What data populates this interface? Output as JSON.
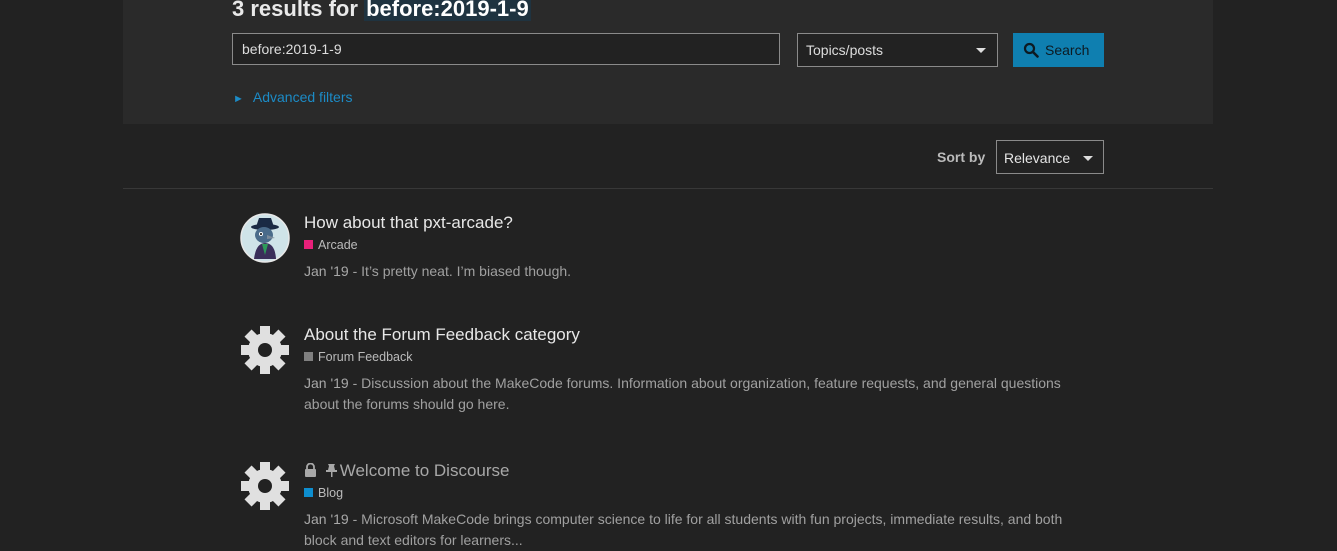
{
  "heading": {
    "prefix": "3 results for",
    "term": "before:2019-1-9"
  },
  "search": {
    "input_value": "before:2019-1-9",
    "type_selected": "Topics/posts",
    "button_label": "Search",
    "advanced_filters_label": "Advanced filters"
  },
  "sort": {
    "label": "Sort by",
    "selected": "Relevance"
  },
  "results": [
    {
      "title": "How about that pxt-arcade?",
      "category": "Arcade",
      "category_color": "#e8207a",
      "date": "Jan '19",
      "separator": " - ",
      "blurb": "It’s pretty neat. I’m biased though.",
      "avatar": "user-avatar"
    },
    {
      "title": "About the Forum Feedback category",
      "category": "Forum Feedback",
      "category_color": "#808080",
      "date": "Jan '19",
      "separator": " - ",
      "blurb": "Discussion about the MakeCode forums. Information about organization, feature requests, and general questions about the forums should go here.",
      "avatar": "gear-icon"
    },
    {
      "title": "Welcome to Discourse",
      "category": "Blog",
      "category_color": "#0e8ecf",
      "date": "Jan '19",
      "separator": " - ",
      "blurb": "Microsoft MakeCode brings computer science to life for all students with fun projects, immediate results, and both block and text editors for learners...",
      "avatar": "gear-icon",
      "status_icons": [
        "lock-icon",
        "pin-icon"
      ]
    }
  ]
}
